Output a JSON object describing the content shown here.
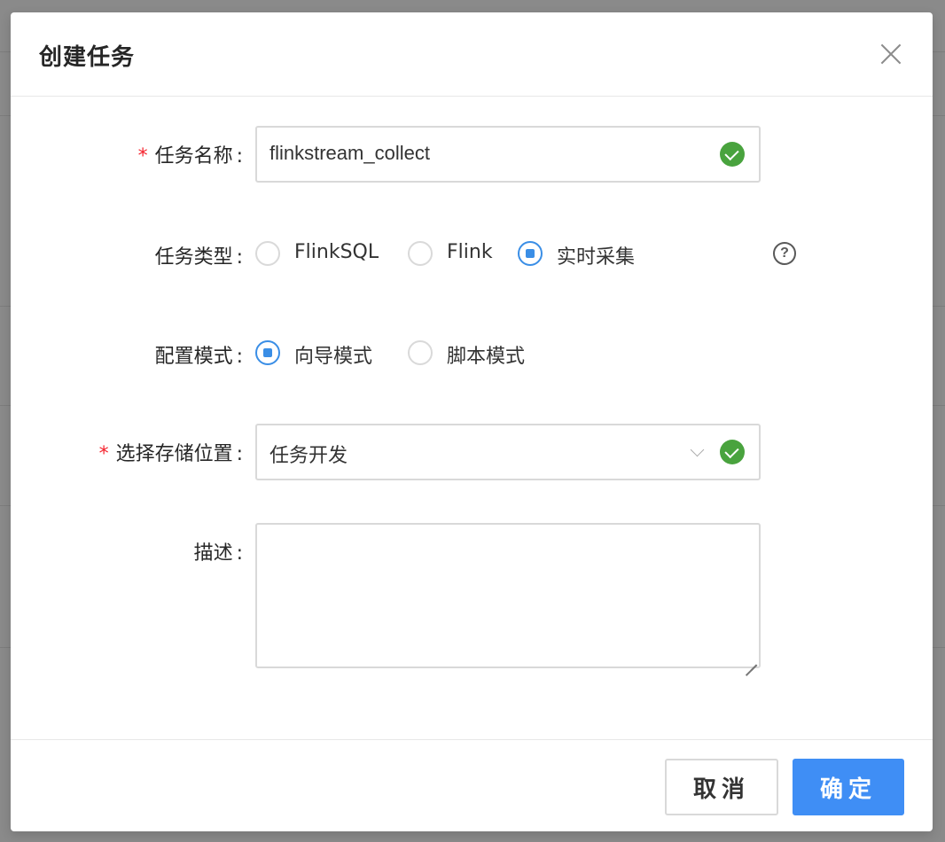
{
  "modal": {
    "title": "创建任务"
  },
  "form": {
    "task_name": {
      "label": "任务名称",
      "required": true,
      "value": "flinkstream_collect"
    },
    "task_type": {
      "label": "任务类型",
      "options": [
        "FlinkSQL",
        "Flink",
        "实时采集"
      ],
      "selected": "实时采集"
    },
    "config_mode": {
      "label": "配置模式",
      "options": [
        "向导模式",
        "脚本模式"
      ],
      "selected": "向导模式"
    },
    "storage_location": {
      "label": "选择存储位置",
      "required": true,
      "value": "任务开发"
    },
    "description": {
      "label": "描述",
      "value": ""
    },
    "required_mark": "*",
    "colon": ":"
  },
  "footer": {
    "cancel_label": "取消",
    "ok_label": "确定"
  },
  "icons": {
    "close": "close-icon",
    "valid": "check-circle-icon",
    "help": "question-circle-icon",
    "dropdown": "chevron-down-icon"
  },
  "colors": {
    "primary": "#3f8ef5",
    "success": "#49a33e",
    "required": "#f5222d"
  }
}
